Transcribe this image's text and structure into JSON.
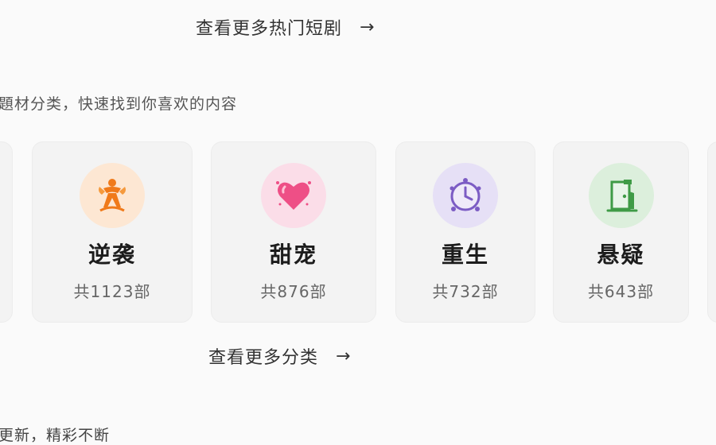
{
  "more_hot": {
    "label": "查看更多热门短剧",
    "arrow": "→"
  },
  "subtitle": "題材分类，快速找到你喜欢的内容",
  "categories": [
    {
      "name": "逆袭",
      "count": "共1123部",
      "icon": "rising-figure-icon",
      "bg": "#fde7d3",
      "color": "#f07a1a"
    },
    {
      "name": "甜宠",
      "count": "共876部",
      "icon": "heart-icon",
      "bg": "#fbdde8",
      "color": "#ee4f86"
    },
    {
      "name": "重生",
      "count": "共732部",
      "icon": "clock-icon",
      "bg": "#e6e0f6",
      "color": "#7c5cc4"
    },
    {
      "name": "悬疑",
      "count": "共643部",
      "icon": "door-icon",
      "bg": "#dcefdc",
      "color": "#3f9b46"
    }
  ],
  "more_cat": {
    "label": "查看更多分类",
    "arrow": "→"
  },
  "bottom_text": "更新，精彩不断"
}
